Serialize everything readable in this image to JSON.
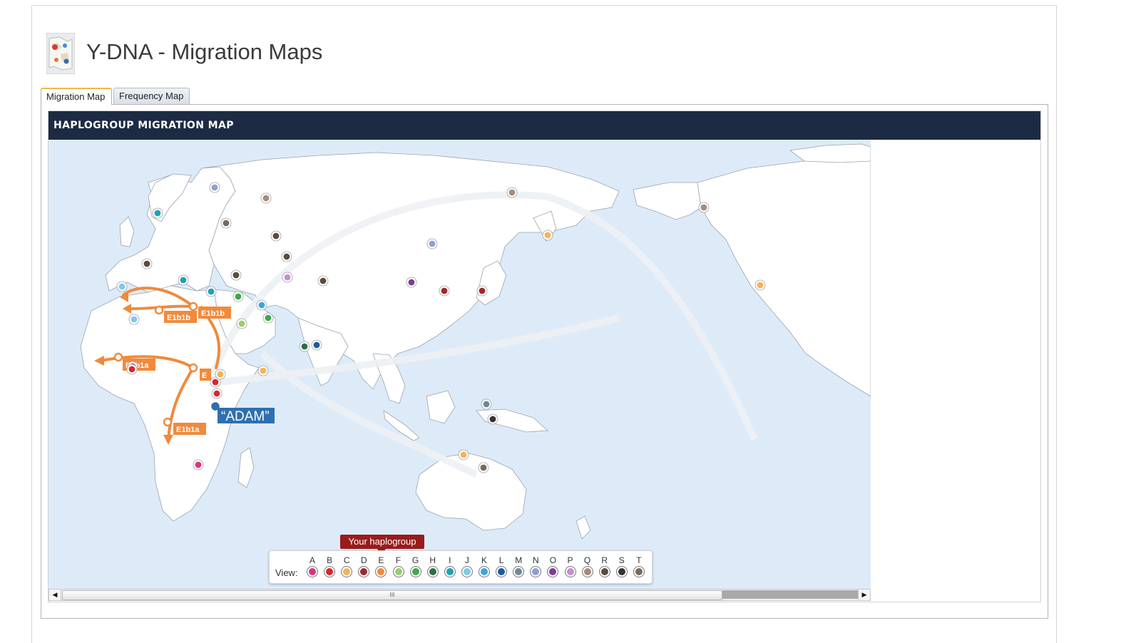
{
  "page": {
    "title": "Y-DNA - Migration Maps"
  },
  "tabs": [
    {
      "label": "Migration Map",
      "active": true
    },
    {
      "label": "Frequency Map",
      "active": false
    }
  ],
  "map": {
    "header": "HAPLOGROUP MIGRATION MAP",
    "origin_label": "“ADAM”",
    "migration_labels": [
      "E1b1b",
      "E1b1b",
      "E1b1a",
      "E1b1a",
      "E"
    ],
    "colors": {
      "ocean": "#ddebf9",
      "land": "#ffffff",
      "migration": "#f08a3c",
      "origin": "#2f6fb0"
    }
  },
  "legend": {
    "view_label": "View:",
    "your_haplogroup_label": "Your haplogroup",
    "selected": "E",
    "haplogroups": [
      {
        "letter": "A",
        "color": "#d9347e"
      },
      {
        "letter": "B",
        "color": "#d9262f"
      },
      {
        "letter": "C",
        "color": "#f5b353"
      },
      {
        "letter": "D",
        "color": "#a02830"
      },
      {
        "letter": "E",
        "color": "#f08a3c"
      },
      {
        "letter": "F",
        "color": "#9ccc6f"
      },
      {
        "letter": "G",
        "color": "#3ea94a"
      },
      {
        "letter": "H",
        "color": "#2e6f47"
      },
      {
        "letter": "I",
        "color": "#1ea1b4"
      },
      {
        "letter": "J",
        "color": "#7fc9ec"
      },
      {
        "letter": "K",
        "color": "#3ba6dd"
      },
      {
        "letter": "L",
        "color": "#1b5aa3"
      },
      {
        "letter": "M",
        "color": "#6f8899"
      },
      {
        "letter": "N",
        "color": "#8e9fd3"
      },
      {
        "letter": "O",
        "color": "#7a3e93"
      },
      {
        "letter": "P",
        "color": "#c78fcf"
      },
      {
        "letter": "Q",
        "color": "#a68a7a"
      },
      {
        "letter": "R",
        "color": "#5c4a3a"
      },
      {
        "letter": "S",
        "color": "#3a3030"
      },
      {
        "letter": "T",
        "color": "#786a5e"
      }
    ]
  },
  "markers": [
    {
      "group": "A",
      "color": "#d9347e"
    },
    {
      "group": "A",
      "color": "#d9347e"
    },
    {
      "group": "B",
      "color": "#d9262f"
    },
    {
      "group": "B",
      "color": "#d9262f"
    },
    {
      "group": "B",
      "color": "#d9262f"
    },
    {
      "group": "C",
      "color": "#f5b353"
    },
    {
      "group": "C",
      "color": "#f5b353"
    },
    {
      "group": "C",
      "color": "#f5b353"
    },
    {
      "group": "C",
      "color": "#f5b353"
    },
    {
      "group": "C",
      "color": "#f5b353"
    },
    {
      "group": "D",
      "color": "#a02830"
    },
    {
      "group": "D",
      "color": "#a02830"
    },
    {
      "group": "F",
      "color": "#9ccc6f"
    },
    {
      "group": "G",
      "color": "#3ea94a"
    },
    {
      "group": "G",
      "color": "#3ea94a"
    },
    {
      "group": "H",
      "color": "#2e6f47"
    },
    {
      "group": "I",
      "color": "#1ea1b4"
    },
    {
      "group": "I",
      "color": "#1ea1b4"
    },
    {
      "group": "I",
      "color": "#1ea1b4"
    },
    {
      "group": "J",
      "color": "#7fc9ec"
    },
    {
      "group": "J",
      "color": "#7fc9ec"
    },
    {
      "group": "K",
      "color": "#3ba6dd"
    },
    {
      "group": "L",
      "color": "#1b5aa3"
    },
    {
      "group": "M",
      "color": "#6f8899"
    },
    {
      "group": "N",
      "color": "#8e9fd3"
    },
    {
      "group": "N",
      "color": "#8e9fd3"
    },
    {
      "group": "O",
      "color": "#7a3e93"
    },
    {
      "group": "P",
      "color": "#c78fcf"
    },
    {
      "group": "Q",
      "color": "#a68a7a"
    },
    {
      "group": "Q",
      "color": "#a68a7a"
    },
    {
      "group": "Q",
      "color": "#a68a7a"
    },
    {
      "group": "R",
      "color": "#5c4a3a"
    },
    {
      "group": "R",
      "color": "#5c4a3a"
    },
    {
      "group": "R",
      "color": "#5c4a3a"
    },
    {
      "group": "R",
      "color": "#5c4a3a"
    },
    {
      "group": "R",
      "color": "#5c4a3a"
    },
    {
      "group": "S",
      "color": "#3a3030"
    },
    {
      "group": "T",
      "color": "#786a5e"
    },
    {
      "group": "T",
      "color": "#786a5e"
    }
  ],
  "scrollbar": {
    "grip": "III"
  }
}
